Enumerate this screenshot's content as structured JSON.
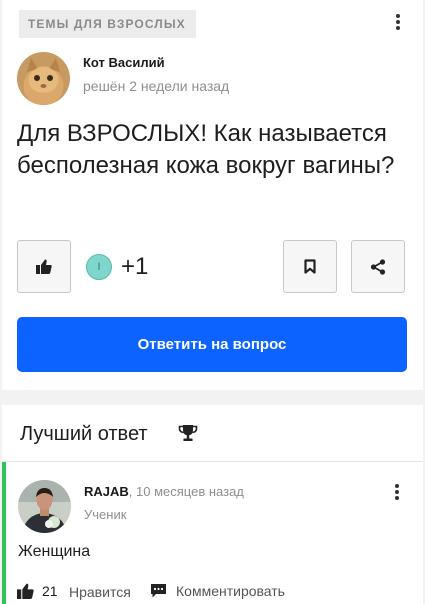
{
  "question": {
    "category": "ТЕМЫ ДЛЯ ВЗРОСЛЫХ",
    "author": "Кот Василий",
    "time": "решён 2 недели назад",
    "title": "Для ВЗРОСЛЫХ! Как называется бесполезная кожа вокруг вагины?",
    "voter_initial": "I",
    "score": "+1",
    "answer_button": "Ответить на вопрос"
  },
  "best_answer": {
    "heading": "Лучший ответ",
    "author": "RAJAB",
    "time": ", 10 месяцев назад",
    "rank": "Ученик",
    "text": "Женщина",
    "likes": "21",
    "like_label": "Нравится",
    "comment_label": "Комментировать"
  },
  "colors": {
    "accent": "#0d63ff",
    "best_bar": "#2fc35a",
    "voter_bg": "#7fd6cc"
  }
}
